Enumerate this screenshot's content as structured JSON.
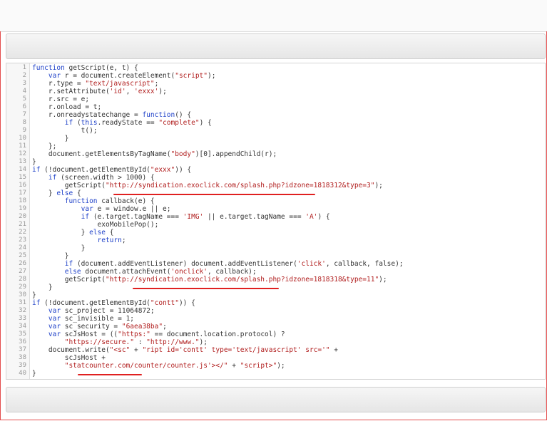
{
  "editor": {
    "lines": [
      {
        "n": "1",
        "text": "function getScript(e, t) {"
      },
      {
        "n": "2",
        "text": "    var r = document.createElement(\"script\");"
      },
      {
        "n": "3",
        "text": "    r.type = \"text/javascript\";"
      },
      {
        "n": "4",
        "text": "    r.setAttribute('id', 'exxx');"
      },
      {
        "n": "5",
        "text": "    r.src = e;"
      },
      {
        "n": "6",
        "text": "    r.onload = t;"
      },
      {
        "n": "7",
        "text": "    r.onreadystatechange = function() {"
      },
      {
        "n": "8",
        "text": "        if (this.readyState == \"complete\") {"
      },
      {
        "n": "9",
        "text": "            t();"
      },
      {
        "n": "10",
        "text": "        }"
      },
      {
        "n": "11",
        "text": "    };"
      },
      {
        "n": "12",
        "text": "    document.getElementsByTagName(\"body\")[0].appendChild(r);"
      },
      {
        "n": "13",
        "text": "}"
      },
      {
        "n": "14",
        "text": "if (!document.getElementById(\"exxx\")) {"
      },
      {
        "n": "15",
        "text": "    if (screen.width > 1000) {"
      },
      {
        "n": "16",
        "text": "        getScript(\"http://syndication.exoclick.com/splash.php?idzone=1818312&type=3\");"
      },
      {
        "n": "17",
        "text": "    } else {"
      },
      {
        "n": "18",
        "text": "        function callback(e) {"
      },
      {
        "n": "19",
        "text": "            var e = window.e || e;"
      },
      {
        "n": "20",
        "text": "            if (e.target.tagName === 'IMG' || e.target.tagName === 'A') {"
      },
      {
        "n": "21",
        "text": "                exoMobilePop();"
      },
      {
        "n": "22",
        "text": "            } else {"
      },
      {
        "n": "23",
        "text": "                return;"
      },
      {
        "n": "24",
        "text": "            }"
      },
      {
        "n": "25",
        "text": "        }"
      },
      {
        "n": "26",
        "text": "        if (document.addEventListener) document.addEventListener('click', callback, false);"
      },
      {
        "n": "27",
        "text": "        else document.attachEvent('onclick', callback);"
      },
      {
        "n": "28",
        "text": "        getScript(\"http://syndication.exoclick.com/splash.php?idzone=1818318&type=11\");"
      },
      {
        "n": "29",
        "text": "    }"
      },
      {
        "n": "30",
        "text": "}"
      },
      {
        "n": "31",
        "text": "if (!document.getElementById(\"contt\")) {"
      },
      {
        "n": "32",
        "text": "    var sc_project = 11064872;"
      },
      {
        "n": "33",
        "text": "    var sc_invisible = 1;"
      },
      {
        "n": "34",
        "text": "    var sc_security = \"6aea38ba\";"
      },
      {
        "n": "35",
        "text": "    var scJsHost = ((\"https:\" == document.location.protocol) ?"
      },
      {
        "n": "36",
        "text": "        \"https://secure.\" : \"http://www.\");"
      },
      {
        "n": "37",
        "text": "    document.write(\"<sc\" + \"ript id='contt' type='text/javascript' src='\" +"
      },
      {
        "n": "38",
        "text": "        scJsHost +"
      },
      {
        "n": "39",
        "text": "        \"statcounter.com/counter/counter.js'></\" + \"script>\");"
      },
      {
        "n": "40",
        "text": "}"
      }
    ]
  },
  "annotations": {
    "underline_color": "#e02020"
  }
}
